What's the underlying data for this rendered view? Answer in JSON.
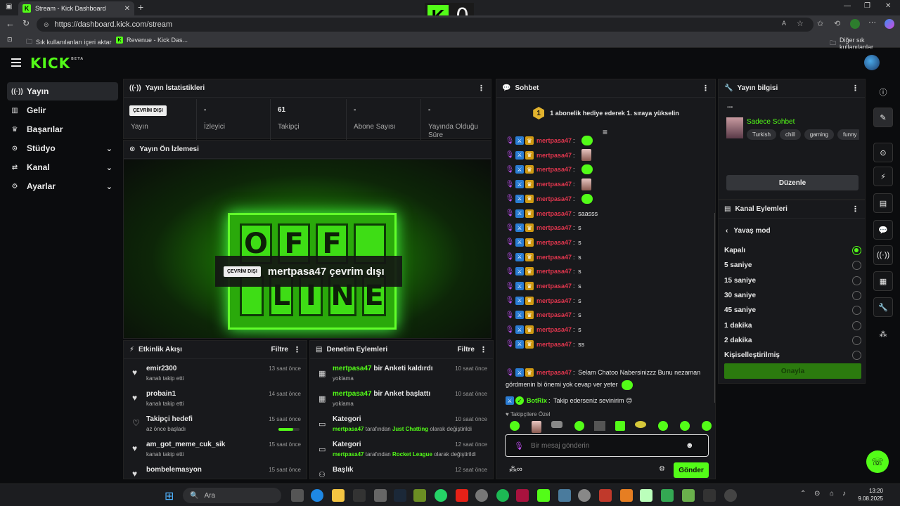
{
  "browser": {
    "tab_title": "Stream - Kick Dashboard",
    "url": "https://dashboard.kick.com/stream",
    "bookmark_import": "Sık kullanılanları içeri aktar",
    "bookmark_revenue": "Revenue - Kick Das...",
    "bookmark_other": "Diğer sık kullanılanlar"
  },
  "overlay": {
    "score": "0"
  },
  "nav": {
    "logo": "KICK",
    "logo_sup": "BETA"
  },
  "sidebar": {
    "items": [
      {
        "label": "Yayın",
        "icon": "broadcast-icon"
      },
      {
        "label": "Gelir",
        "icon": "revenue-icon"
      },
      {
        "label": "Başarılar",
        "icon": "trophy-icon"
      },
      {
        "label": "Stüdyo",
        "icon": "studio-icon"
      },
      {
        "label": "Kanal",
        "icon": "channel-icon"
      },
      {
        "label": "Ayarlar",
        "icon": "gear-icon"
      }
    ]
  },
  "stats": {
    "title": "Yayın İstatistikleri",
    "status_badge": "ÇEVRİM DIŞI",
    "cells": [
      {
        "value": "",
        "label": "Yayın"
      },
      {
        "value": "-",
        "label": "İzleyici"
      },
      {
        "value": "61",
        "label": "Takipçi"
      },
      {
        "value": "-",
        "label": "Abone Sayısı"
      },
      {
        "value": "-",
        "label": "Yayında Olduğu Süre"
      }
    ]
  },
  "preview": {
    "title": "Yayın Ön İzlemesi",
    "badge": "ÇEVRİM DIŞI",
    "text": "mertpasa47 çevrim dışı",
    "sign_top": [
      "O",
      "F",
      "F",
      ""
    ],
    "sign_bottom": [
      "",
      "L",
      "I",
      "N",
      "E"
    ]
  },
  "activity": {
    "title": "Etkinlik Akışı",
    "filter": "Filtre",
    "items": [
      {
        "name": "emir2300",
        "sub": "kanalı takip etti",
        "time": "13 saat önce"
      },
      {
        "name": "probain1",
        "sub": "kanalı takip etti",
        "time": "14 saat önce"
      },
      {
        "name": "Takipçi hedefi",
        "sub": "az önce başladı",
        "time": "15 saat önce",
        "progress": 0.7
      },
      {
        "name": "am_got_meme_cuk_sik",
        "sub": "kanalı takip etti",
        "time": "15 saat önce"
      },
      {
        "name": "bombelemasyon",
        "sub": "",
        "time": "15 saat önce"
      }
    ]
  },
  "moderation": {
    "title": "Denetim Eylemleri",
    "filter": "Filtre",
    "items": [
      {
        "user": "mertpasa47",
        "action": "bir Anketi kaldırdı",
        "sub": "yoklama",
        "time": "10 saat önce"
      },
      {
        "user": "mertpasa47",
        "action": "bir Anket başlattı",
        "sub": "yoklama",
        "time": "10 saat önce"
      },
      {
        "user": "",
        "action": "Kategori",
        "sub_user": "mertpasa47",
        "sub_mid": "tarafından",
        "sub_cat": "Just Chatting",
        "sub_end": "olarak değiştirildi",
        "time": "10 saat önce"
      },
      {
        "user": "",
        "action": "Kategori",
        "sub_user": "mertpasa47",
        "sub_mid": "tarafından",
        "sub_cat": "Rocket League",
        "sub_end": "olarak değiştirildi",
        "time": "12 saat önce"
      },
      {
        "user": "",
        "action": "Başlık",
        "sub": "",
        "time": "12 saat önce"
      }
    ]
  },
  "chat": {
    "title": "Sohbet",
    "banner_rank": "1",
    "banner": "1 abonelik hediye ederek 1. sıraya yükselin",
    "username": "mertpasa47",
    "messages": [
      {
        "text": "",
        "emote": "green"
      },
      {
        "text": "",
        "emote": "anime"
      },
      {
        "text": "",
        "emote": "green"
      },
      {
        "text": "",
        "emote": "anime"
      },
      {
        "text": "",
        "emote": "green"
      },
      {
        "text": "saasss",
        "emote": ""
      },
      {
        "text": "s",
        "emote": ""
      },
      {
        "text": "s",
        "emote": ""
      },
      {
        "text": "s",
        "emote": ""
      },
      {
        "text": "s",
        "emote": ""
      },
      {
        "text": "s",
        "emote": ""
      },
      {
        "text": "s",
        "emote": ""
      },
      {
        "text": "s",
        "emote": ""
      },
      {
        "text": "s",
        "emote": ""
      },
      {
        "text": "ss",
        "emote": ""
      }
    ],
    "long_msg_line1": "Selam Chatoo Nabersinizzz Bunu nezaman",
    "long_msg_line2": "gördmenin bi önemi yok cevap ver yeter",
    "bot_name": "BotRix",
    "bot_msg": "Takip ederseniz sevinirim 😊",
    "followers_only": "Takipçilere Özel",
    "input_placeholder": "Bir mesaj gönderin",
    "send": "Gönder"
  },
  "stream_info": {
    "title": "Yayın bilgisi",
    "ellipsis": "...",
    "stream_title": "Sadece Sohbet",
    "tags": [
      "Turkish",
      "chill",
      "gaming",
      "funny"
    ],
    "edit": "Düzenle"
  },
  "channel_actions": {
    "title": "Kanal Eylemleri",
    "back": "Yavaş mod",
    "options": [
      "Kapalı",
      "5 saniye",
      "15 saniye",
      "30 saniye",
      "45 saniye",
      "1 dakika",
      "2 dakika",
      "Kişiselleştirilmiş"
    ],
    "selected": 0,
    "approve": "Onayla"
  },
  "taskbar": {
    "search": "Ara",
    "time": "13:20",
    "date": "9.08.2025"
  },
  "colors": {
    "accent": "#53fc18",
    "username": "#e2364e",
    "panel": "#18191c"
  }
}
